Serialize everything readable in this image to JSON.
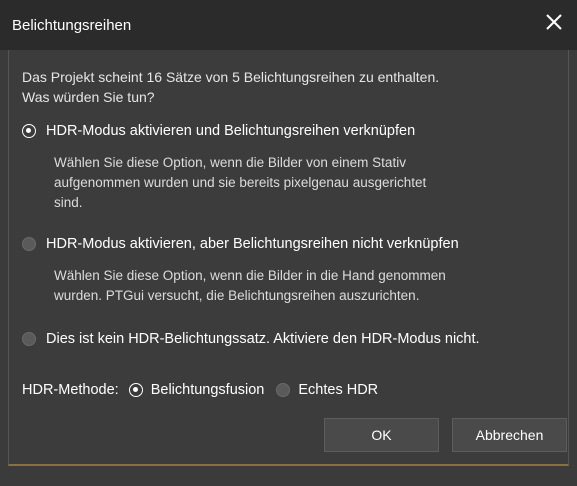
{
  "window": {
    "title": "Belichtungsreihen",
    "close_icon": "close-icon"
  },
  "intro": {
    "line1": "Das Projekt scheint 16 Sätze von 5 Belichtungsreihen zu enthalten.",
    "line2": "Was würden Sie tun?"
  },
  "options": [
    {
      "label": "HDR-Modus aktivieren und Belichtungsreihen verknüpfen",
      "selected": true,
      "desc": [
        "Wählen Sie diese Option, wenn die Bilder von einem Stativ",
        "aufgenommen wurden und sie bereits pixelgenau ausgerichtet",
        "sind."
      ]
    },
    {
      "label": "HDR-Modus aktivieren, aber Belichtungsreihen nicht verknüpfen",
      "selected": false,
      "desc": [
        "Wählen Sie diese Option, wenn die Bilder in die Hand genommen",
        "wurden. PTGui versucht, die Belichtungsreihen auszurichten."
      ]
    },
    {
      "label": "Dies ist kein HDR-Belichtungssatz. Aktiviere den HDR-Modus nicht.",
      "selected": false,
      "desc": []
    }
  ],
  "method": {
    "label": "HDR-Methode:",
    "choices": [
      {
        "label": "Belichtungsfusion",
        "selected": true
      },
      {
        "label": "Echtes HDR",
        "selected": false
      }
    ]
  },
  "buttons": {
    "ok": "OK",
    "cancel": "Abbrechen"
  },
  "colors": {
    "background": "#3b3b3b",
    "titlebar": "#2b2b2b",
    "accent_border": "#8a7040"
  }
}
